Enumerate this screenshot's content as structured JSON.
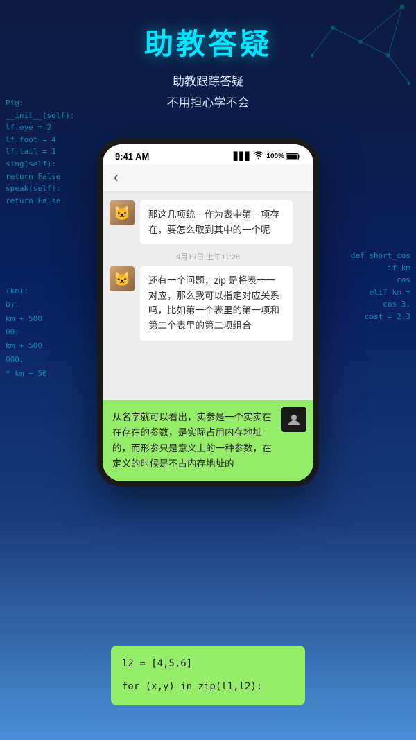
{
  "background": {
    "colors": {
      "top": "#0d1b3e",
      "mid": "#0a2060",
      "bottom": "#4a8fd4"
    }
  },
  "title": {
    "main": "助教答疑",
    "sub_line1": "助教跟踪答疑",
    "sub_line2": "不用担心学不会"
  },
  "status_bar": {
    "time": "9:41 AM",
    "signal": "▋▋▋",
    "wifi": "WiFi",
    "battery": "100%"
  },
  "chat_header": {
    "back": "‹"
  },
  "messages": [
    {
      "id": "msg1",
      "sender": "student",
      "avatar": "🐱",
      "text": "那这几项统一作为表中第一项存在，要怎么取到其中的一个呢"
    },
    {
      "id": "timestamp1",
      "type": "timestamp",
      "text": "4月19日 上午11:28"
    },
    {
      "id": "msg2",
      "sender": "student",
      "avatar": "🐱",
      "text": "还有一个问题，zip 是将表一一对应，那么我可以指定对应关系吗，比如第一个表里的第一项和第二个表里的第二项组合"
    }
  ],
  "reply_bubble": {
    "text": "从名字就可以看出，实参是一个实实在在存在的参数，是实际占用内存地址的，而形参只是意义上的一种参数，在定义的时候是不占内存地址的",
    "avatar": "👤"
  },
  "code_bubble": {
    "line1": "l2 = [4,5,6]",
    "line2": "",
    "line3": "for (x,y) in zip(l1,l2):"
  },
  "code_left": {
    "lines": [
      "Pig:",
      "  __init__(self):",
      "  lf.eye = 2",
      "  lf.foot = 4",
      "  lf.tail = 1",
      "  sing(self):",
      "  return False",
      "  speak(self):",
      "  return False"
    ]
  },
  "code_left_bottom": {
    "lines": [
      "(km):",
      "0):",
      "  km + 500",
      "00:",
      "  km + 500",
      "000:",
      " * km + 50"
    ]
  },
  "code_right": {
    "lines": [
      "def short_cos",
      "  if km",
      "    cos",
      "  elif km =",
      "    cos  3.",
      "  cost = 2.3"
    ]
  }
}
